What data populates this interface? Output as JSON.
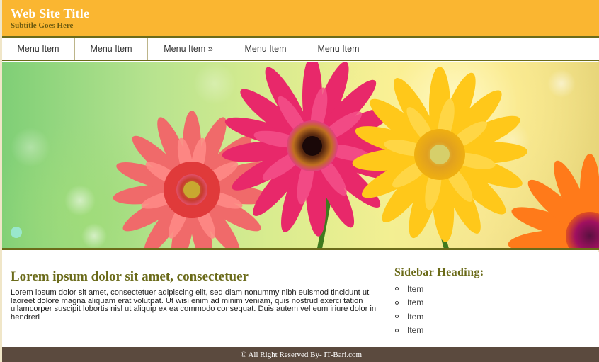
{
  "header": {
    "title": "Web Site Title",
    "subtitle": "Subtitle Goes Here"
  },
  "nav": {
    "items": [
      {
        "label": "Menu Item"
      },
      {
        "label": "Menu Item"
      },
      {
        "label": "Menu Item »"
      },
      {
        "label": "Menu Item"
      },
      {
        "label": "Menu Item"
      }
    ]
  },
  "banner": {
    "image": "gerbera-flowers-banner"
  },
  "main": {
    "heading": "Lorem ipsum dolor sit amet, consectetuer",
    "paragraph": "Lorem ipsum dolor sit amet, consectetuer adipiscing elit, sed diam nonummy nibh euismod tincidunt ut laoreet dolore magna aliquam erat volutpat. Ut wisi enim ad minim veniam, quis nostrud exerci tation ullamcorper suscipit lobortis nisl ut aliquip ex ea commodo consequat. Duis autem vel eum iriure dolor in hendreri"
  },
  "sidebar": {
    "heading": "Sidebar Heading:",
    "items": [
      {
        "label": "Item"
      },
      {
        "label": "Item"
      },
      {
        "label": "Item"
      },
      {
        "label": "Item"
      }
    ]
  },
  "footer": {
    "text": "© All Right Reserved By- IT-Bari.com"
  },
  "colors": {
    "header_bg": "#fab631",
    "accent_olive": "#6b6b1a",
    "footer_bg": "#5b4a3e"
  }
}
